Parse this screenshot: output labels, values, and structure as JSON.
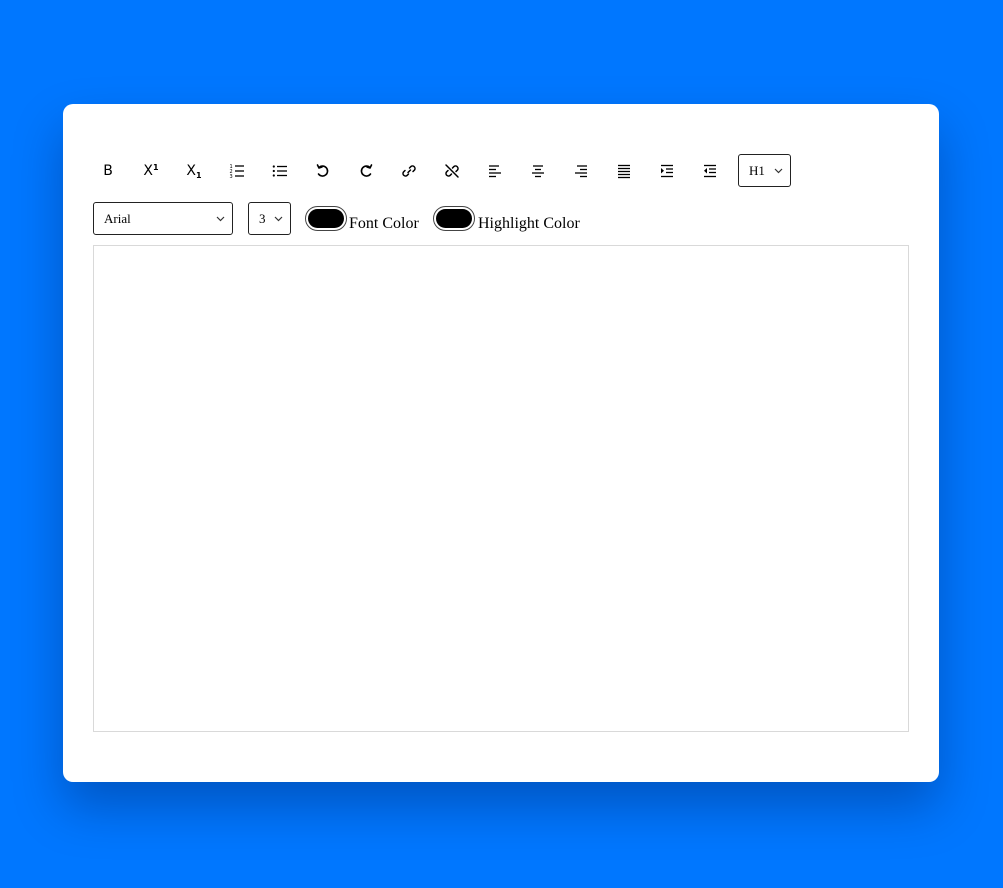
{
  "colors": {
    "background": "#0077ff",
    "card": "#ffffff",
    "swatch": "#000000"
  },
  "toolbar": {
    "buttons": [
      {
        "name": "bold-button",
        "icon": "bold-icon",
        "label": "B"
      },
      {
        "name": "superscript-button",
        "icon": "superscript-icon",
        "label": "X",
        "mark": "1"
      },
      {
        "name": "subscript-button",
        "icon": "subscript-icon",
        "label": "X",
        "mark": "1"
      },
      {
        "name": "ordered-list-button",
        "icon": "ordered-list-icon"
      },
      {
        "name": "unordered-list-button",
        "icon": "unordered-list-icon"
      },
      {
        "name": "undo-button",
        "icon": "undo-icon"
      },
      {
        "name": "redo-button",
        "icon": "redo-icon"
      },
      {
        "name": "link-button",
        "icon": "link-icon"
      },
      {
        "name": "unlink-button",
        "icon": "unlink-icon"
      },
      {
        "name": "align-left-button",
        "icon": "align-left-icon"
      },
      {
        "name": "align-center-button",
        "icon": "align-center-icon"
      },
      {
        "name": "align-right-button",
        "icon": "align-right-icon"
      },
      {
        "name": "justify-button",
        "icon": "justify-icon"
      },
      {
        "name": "indent-button",
        "icon": "indent-icon"
      },
      {
        "name": "outdent-button",
        "icon": "outdent-icon"
      }
    ],
    "heading_select": {
      "value": "H1"
    }
  },
  "format_bar": {
    "font_select": {
      "value": "Arial"
    },
    "size_select": {
      "value": "3"
    },
    "font_color": {
      "label": "Font Color",
      "value": "#000000"
    },
    "highlight_color": {
      "label": "Highlight Color",
      "value": "#000000"
    }
  },
  "editor": {
    "content": ""
  }
}
